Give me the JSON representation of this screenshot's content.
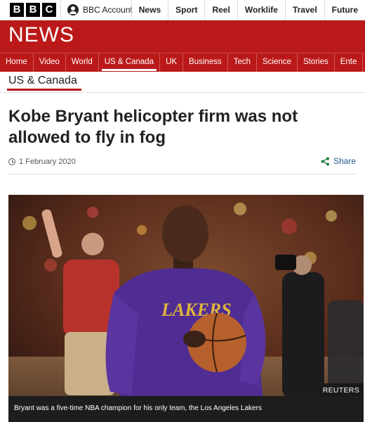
{
  "brand": {
    "logo_letters": [
      "B",
      "B",
      "C"
    ],
    "account_label": "BBC Account"
  },
  "top_nav": [
    "News",
    "Sport",
    "Reel",
    "Worklife",
    "Travel",
    "Future"
  ],
  "banner": {
    "title": "NEWS",
    "color": "#bb1919"
  },
  "section_nav": {
    "items": [
      "Home",
      "Video",
      "World",
      "US & Canada",
      "UK",
      "Business",
      "Tech",
      "Science",
      "Stories",
      "Ente"
    ],
    "active": "US & Canada"
  },
  "section_title": "US & Canada",
  "article": {
    "headline": "Kobe Bryant helicopter firm was not allowed to fly in fog",
    "date": "1 February 2020",
    "share_label": "Share"
  },
  "image": {
    "credit": "REUTERS",
    "caption": "Bryant was a five-time NBA champion for his only team, the Los Angeles Lakers",
    "jersey_text": "LAKERS"
  },
  "icons": {
    "account": "account-icon",
    "clock": "clock-icon",
    "share": "share-icon"
  },
  "colors": {
    "accent": "#bb1919",
    "link": "#1d5790",
    "share": "#1d7a3f"
  }
}
